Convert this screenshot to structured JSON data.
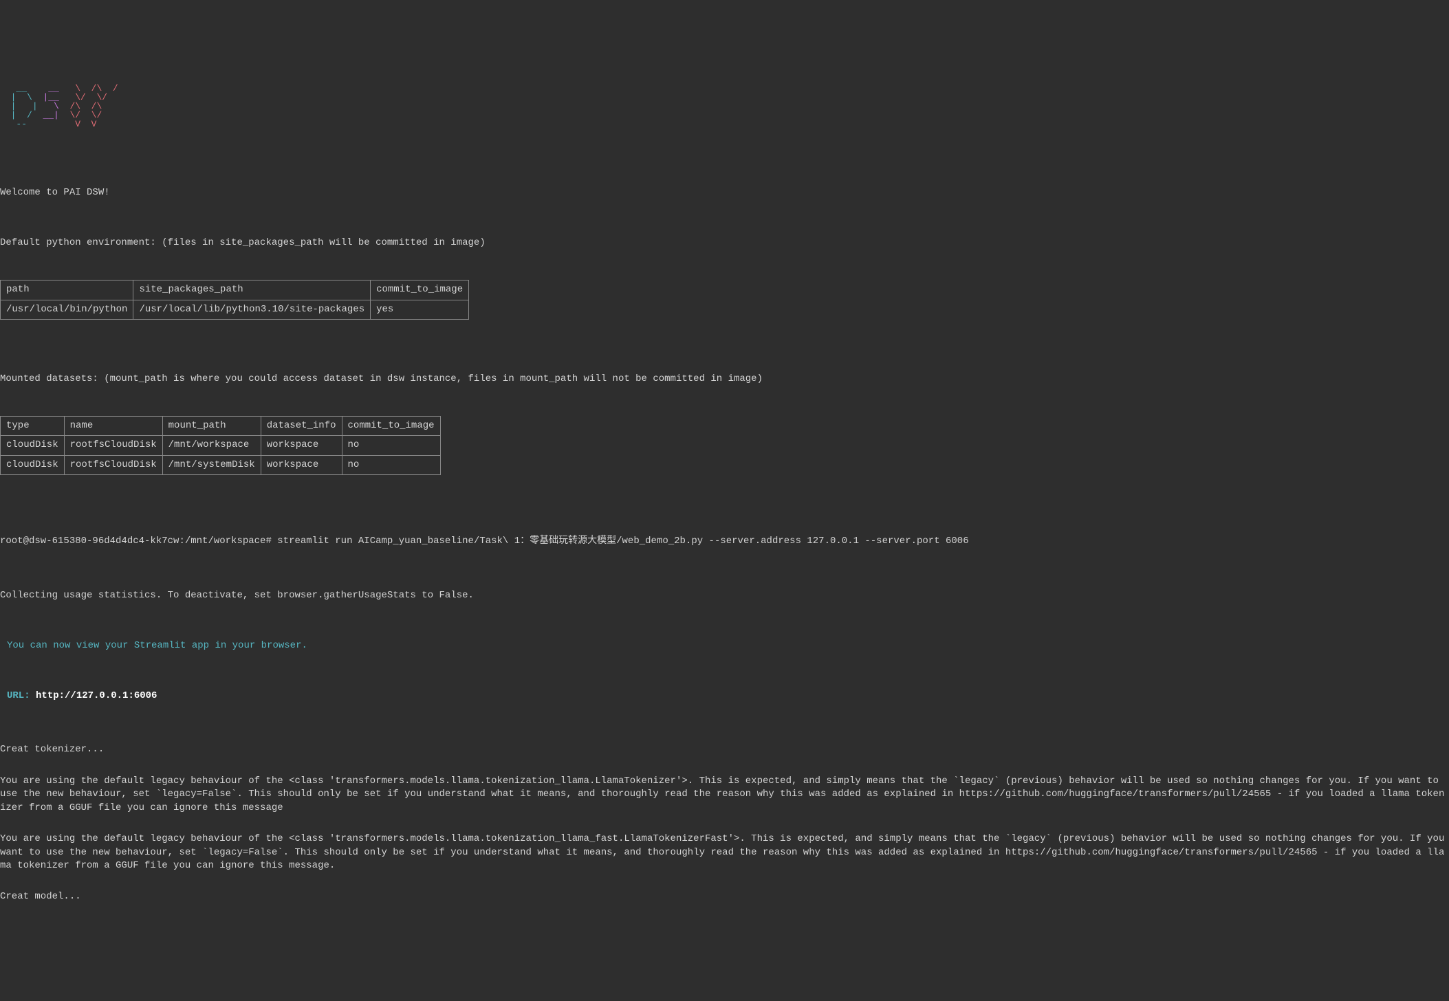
{
  "ascii": [
    " ____    ____   __    __",
    "|    \\  / ___| |  |  |  |",
    "| | \\ \\ \\___ \\ |  |/\\|  |",
    "| |_/ /  ___) ||   /\\   |",
    "|____/  |____/  \\_/  \\_/"
  ],
  "welcome": "Welcome to PAI DSW!",
  "env_header": "Default python environment: (files in site_packages_path will be committed in image)",
  "env_table": {
    "headers": [
      "path",
      "site_packages_path",
      "commit_to_image"
    ],
    "rows": [
      [
        "/usr/local/bin/python",
        "/usr/local/lib/python3.10/site-packages",
        "yes"
      ]
    ]
  },
  "datasets_header": "Mounted datasets: (mount_path is where you could access dataset in dsw instance, files in mount_path will not be committed in image)",
  "datasets_table": {
    "headers": [
      "type",
      "name",
      "mount_path",
      "dataset_info",
      "commit_to_image"
    ],
    "rows": [
      [
        "cloudDisk",
        "rootfsCloudDisk",
        "/mnt/workspace",
        "workspace",
        "no"
      ],
      [
        "cloudDisk",
        "rootfsCloudDisk",
        "/mnt/systemDisk",
        "workspace",
        "no"
      ]
    ]
  },
  "prompt": "root@dsw-615380-96d4d4dc4-kk7cw:/mnt/workspace# streamlit run AICamp_yuan_baseline/Task\\ 1：零基础玩转源大模型/web_demo_2b.py --server.address 127.0.0.1 --server.port 6006",
  "stats_line": "Collecting usage statistics. To deactivate, set browser.gatherUsageStats to False.",
  "view_line": "You can now view your Streamlit app in your browser.",
  "url_label": "URL:",
  "url_value": "http://127.0.0.1:6006",
  "log1": "Creat tokenizer...",
  "log2": "You are using the default legacy behaviour of the <class 'transformers.models.llama.tokenization_llama.LlamaTokenizer'>. This is expected, and simply means that the `legacy` (previous) behavior will be used so nothing changes for you. If you want to use the new behaviour, set `legacy=False`. This should only be set if you understand what it means, and thoroughly read the reason why this was added as explained in https://github.com/huggingface/transformers/pull/24565 - if you loaded a llama tokenizer from a GGUF file you can ignore this message",
  "log3": "You are using the default legacy behaviour of the <class 'transformers.models.llama.tokenization_llama_fast.LlamaTokenizerFast'>. This is expected, and simply means that the `legacy` (previous) behavior will be used so nothing changes for you. If you want to use the new behaviour, set `legacy=False`. This should only be set if you understand what it means, and thoroughly read the reason why this was added as explained in https://github.com/huggingface/transformers/pull/24565 - if you loaded a llama tokenizer from a GGUF file you can ignore this message.",
  "log4": "Creat model..."
}
